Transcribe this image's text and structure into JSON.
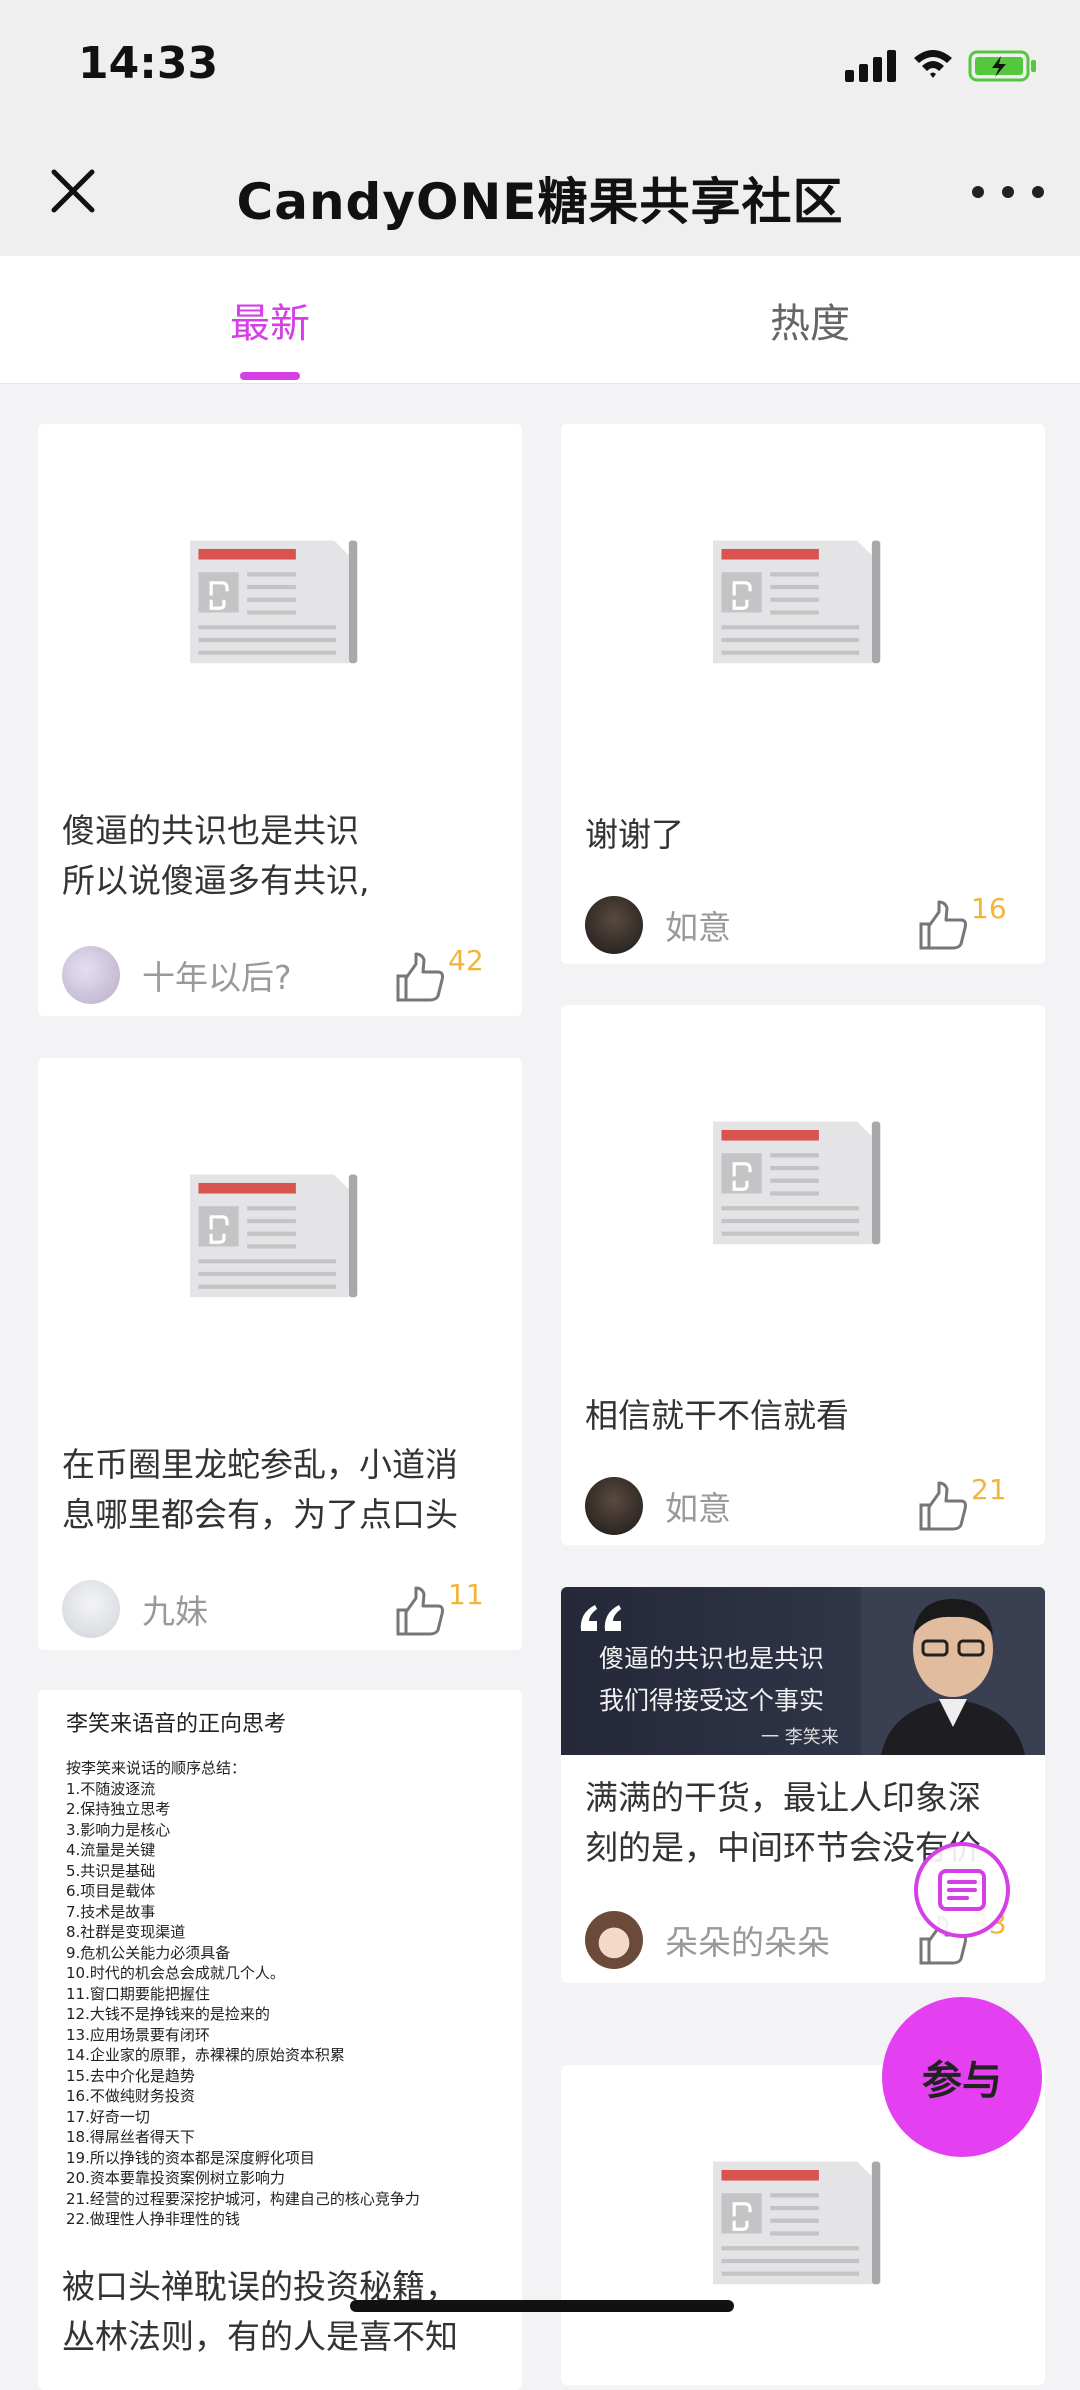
{
  "status_bar": {
    "time": "14:33"
  },
  "nav": {
    "title": "CandyONE糖果共享社区",
    "close_icon": "close-icon",
    "more_icon": "more-icon"
  },
  "tabs": [
    {
      "label": "最新",
      "active": true
    },
    {
      "label": "热度",
      "active": false
    }
  ],
  "cards": [
    {
      "title_lines": [
        "傻逼的共识也是共识",
        "所以说傻逼多有共识,"
      ],
      "author": "十年以后?",
      "likes": "42"
    },
    {
      "title_lines": [
        "谢谢了"
      ],
      "author": "如意",
      "likes": "16"
    },
    {
      "title_lines": [
        "在币圈里龙蛇参乱，小道消",
        "息哪里都会有，为了点口头"
      ],
      "author": "九妹",
      "likes": "11"
    },
    {
      "title_lines": [
        "相信就干不信就看"
      ],
      "author": "如意",
      "likes": "21"
    },
    {
      "quote_lines": [
        "傻逼的共识也是共识",
        "我们得接受这个事实",
        "一 李笑来"
      ],
      "title_lines": [
        "满满的干货，最让人印象深",
        "刻的是，中间环节会没有价"
      ],
      "author": "朵朵的朵朵",
      "likes": "33"
    },
    {
      "doc_heading": "李笑来语音的正向思考",
      "doc_lines": [
        "按李笑来说话的顺序总结：",
        "1.不随波逐流",
        "2.保持独立思考",
        "3.影响力是核心",
        "4.流量是关键",
        "5.共识是基础",
        "6.项目是载体",
        "7.技术是故事",
        "8.社群是变现渠道",
        "9.危机公关能力必须具备",
        "10.时代的机会总会成就几个人。",
        "11.窗口期要能把握住",
        "12.大钱不是挣钱来的是捡来的",
        "13.应用场景要有闭环",
        "14.企业家的原罪，赤裸裸的原始资本积累",
        "15.去中介化是趋势",
        "16.不做纯财务投资",
        "17.好奇一切",
        "18.得屌丝者得天下",
        "19.所以挣钱的资本都是深度孵化项目",
        "20.资本要靠投资案例树立影响力",
        "21.经营的过程要深挖护城河，构建自己的核心竞争力",
        "22.做理性人挣非理性的钱"
      ],
      "title_lines": [
        "被口头禅耽误的投资秘籍，",
        "丛林法则，有的人是喜不知"
      ]
    }
  ],
  "fab": {
    "participate_label": "参与",
    "compose_icon": "compose-icon"
  },
  "colors": {
    "accent": "#d63ee6",
    "likes": "#f2b53b"
  }
}
